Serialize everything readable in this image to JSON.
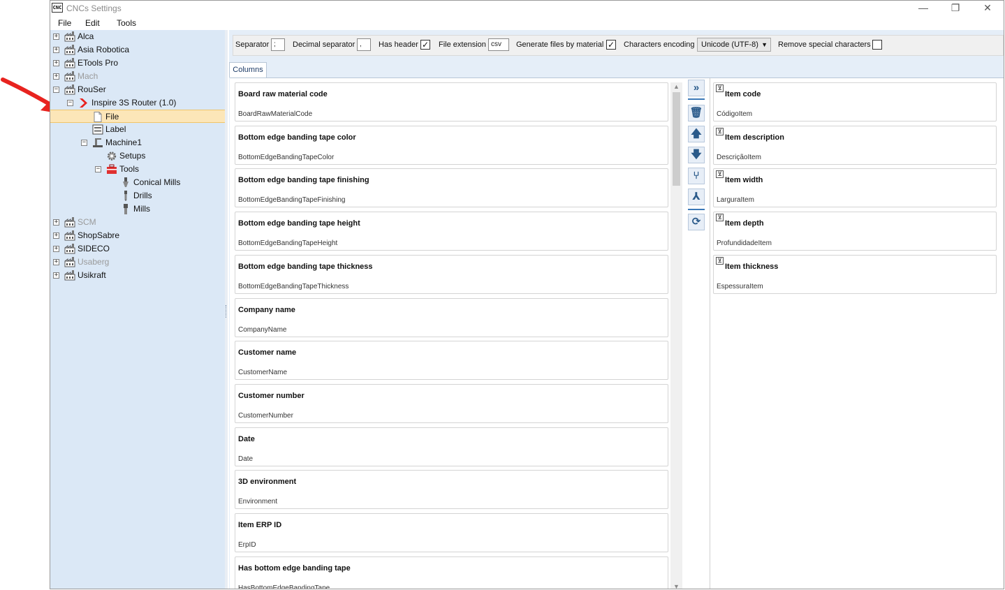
{
  "window": {
    "title": "CNCs Settings",
    "icon_text": "CNC"
  },
  "window_controls": {
    "minimize": "—",
    "restore": "❐",
    "close": "✕"
  },
  "menu": [
    "File",
    "Edit",
    "Tools"
  ],
  "tree": [
    {
      "label": "Alca",
      "icon": "factory-icon",
      "expander": "+"
    },
    {
      "label": "Asia Robotica",
      "icon": "factory-icon",
      "expander": "+"
    },
    {
      "label": "ETools Pro",
      "icon": "factory-icon",
      "expander": "+"
    },
    {
      "label": "Mach",
      "icon": "factory-icon",
      "expander": "+",
      "disabled": true
    },
    {
      "label": "RouSer",
      "icon": "factory-icon",
      "expander": "−"
    },
    {
      "label": "Inspire 3S Router (1.0)",
      "icon": "chevron-right-icon",
      "expander": "−"
    },
    {
      "label": "File",
      "icon": "file-icon",
      "selected": true
    },
    {
      "label": "Label",
      "icon": "label-icon"
    },
    {
      "label": "Machine1",
      "icon": "machine-icon",
      "expander": "−"
    },
    {
      "label": "Setups",
      "icon": "gear-icon"
    },
    {
      "label": "Tools",
      "icon": "toolbox-icon",
      "expander": "−"
    },
    {
      "label": "Conical Mills",
      "icon": "conical-mill-icon"
    },
    {
      "label": "Drills",
      "icon": "drill-icon"
    },
    {
      "label": "Mills",
      "icon": "mill-icon"
    },
    {
      "label": "SCM",
      "icon": "factory-icon",
      "expander": "+",
      "disabled": true
    },
    {
      "label": "ShopSabre",
      "icon": "factory-icon",
      "expander": "+"
    },
    {
      "label": "SIDECO",
      "icon": "factory-icon",
      "expander": "+"
    },
    {
      "label": "Usaberg",
      "icon": "factory-icon",
      "expander": "+",
      "disabled": true
    },
    {
      "label": "Usikraft",
      "icon": "factory-icon",
      "expander": "+"
    }
  ],
  "toolbar": {
    "separator_label": "Separator",
    "separator_value": ";",
    "decimal_separator_label": "Decimal separator",
    "decimal_separator_value": ",",
    "has_header_label": "Has header",
    "has_header_checked": "✓",
    "file_extension_label": "File extension",
    "file_extension_value": "csv",
    "generate_files_label": "Generate files by material",
    "generate_files_checked": "✓",
    "encoding_label": "Characters encoding",
    "encoding_value": "Unicode (UTF-8)",
    "remove_special_label": "Remove special characters",
    "remove_special_checked": ""
  },
  "tabs": {
    "columns": "Columns"
  },
  "available_columns": [
    {
      "title": "Board raw material code",
      "field": "BoardRawMaterialCode"
    },
    {
      "title": "Bottom edge banding tape color",
      "field": "BottomEdgeBandingTapeColor"
    },
    {
      "title": "Bottom edge banding tape finishing",
      "field": "BottomEdgeBandingTapeFinishing"
    },
    {
      "title": "Bottom edge banding tape height",
      "field": "BottomEdgeBandingTapeHeight"
    },
    {
      "title": "Bottom edge banding tape thickness",
      "field": "BottomEdgeBandingTapeThickness"
    },
    {
      "title": "Company name",
      "field": "CompanyName"
    },
    {
      "title": "Customer name",
      "field": "CustomerName"
    },
    {
      "title": "Customer number",
      "field": "CustomerNumber"
    },
    {
      "title": "Date",
      "field": "Date"
    },
    {
      "title": "3D environment",
      "field": "Environment"
    },
    {
      "title": "Item ERP ID",
      "field": "ErpID"
    },
    {
      "title": "Has bottom edge banding tape",
      "field": "HasBottomEdgeBandingTape"
    }
  ],
  "action_buttons": [
    {
      "name": "add-all-button",
      "glyph": "»",
      "icon": "double-chevron-right-icon"
    },
    {
      "name": "delete-button",
      "glyph": "🗑",
      "icon": "trash-icon"
    },
    {
      "name": "move-up-button",
      "glyph": "🡅",
      "icon": "arrow-up-icon"
    },
    {
      "name": "move-down-button",
      "glyph": "🡇",
      "icon": "arrow-down-icon"
    },
    {
      "name": "merge-button",
      "glyph": "⑂",
      "icon": "merge-icon"
    },
    {
      "name": "split-button",
      "glyph": "⅄",
      "icon": "split-icon"
    },
    {
      "name": "reset-button",
      "glyph": "⟳",
      "icon": "refresh-icon"
    }
  ],
  "selected_columns": [
    {
      "title": "Item code",
      "field": "CódigoItem"
    },
    {
      "title": "Item description",
      "field": "DescriçãoItem"
    },
    {
      "title": "Item width",
      "field": "LarguraItem"
    },
    {
      "title": "Item depth",
      "field": "ProfundidadeItem"
    },
    {
      "title": "Item thickness",
      "field": "EspessuraItem"
    }
  ],
  "scrollbar": {
    "up": "▲",
    "down": "▼"
  },
  "collapse_glyph": "⊻",
  "colors": {
    "tree_bg": "#dbe8f6",
    "selection": "#fce6b8",
    "accent": "#2a5a8a",
    "annotation": "#e8231f"
  }
}
